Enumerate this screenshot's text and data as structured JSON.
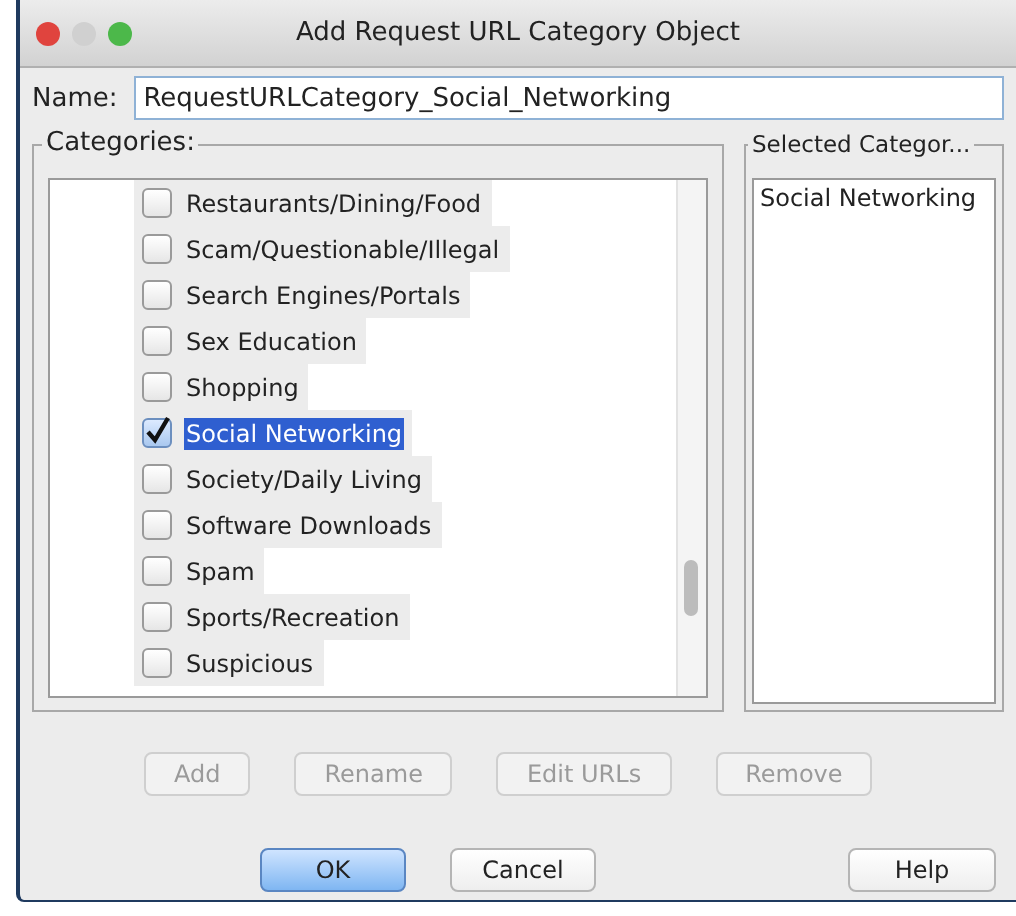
{
  "window": {
    "title": "Add Request URL Category Object"
  },
  "name_field": {
    "label": "Name:",
    "value": "RequestURLCategory_Social_Networking"
  },
  "categories": {
    "label": "Categories:",
    "items": [
      {
        "label": "Restaurants/Dining/Food",
        "checked": false,
        "selected": false
      },
      {
        "label": "Scam/Questionable/Illegal",
        "checked": false,
        "selected": false
      },
      {
        "label": "Search Engines/Portals",
        "checked": false,
        "selected": false
      },
      {
        "label": "Sex Education",
        "checked": false,
        "selected": false
      },
      {
        "label": "Shopping",
        "checked": false,
        "selected": false
      },
      {
        "label": "Social Networking",
        "checked": true,
        "selected": true
      },
      {
        "label": "Society/Daily Living",
        "checked": false,
        "selected": false
      },
      {
        "label": "Software Downloads",
        "checked": false,
        "selected": false
      },
      {
        "label": "Spam",
        "checked": false,
        "selected": false
      },
      {
        "label": "Sports/Recreation",
        "checked": false,
        "selected": false
      },
      {
        "label": "Suspicious",
        "checked": false,
        "selected": false
      }
    ]
  },
  "selected_categories": {
    "label": "Selected Categor...",
    "items": [
      "Social Networking"
    ]
  },
  "category_buttons": [
    {
      "label": "Add",
      "disabled": true
    },
    {
      "label": "Rename",
      "disabled": true
    },
    {
      "label": "Edit URLs",
      "disabled": true
    },
    {
      "label": "Remove",
      "disabled": true
    }
  ],
  "dialog_buttons": [
    {
      "label": "OK",
      "kind": "default"
    },
    {
      "label": "Cancel",
      "kind": "normal"
    },
    {
      "label": "Help",
      "kind": "help"
    }
  ]
}
